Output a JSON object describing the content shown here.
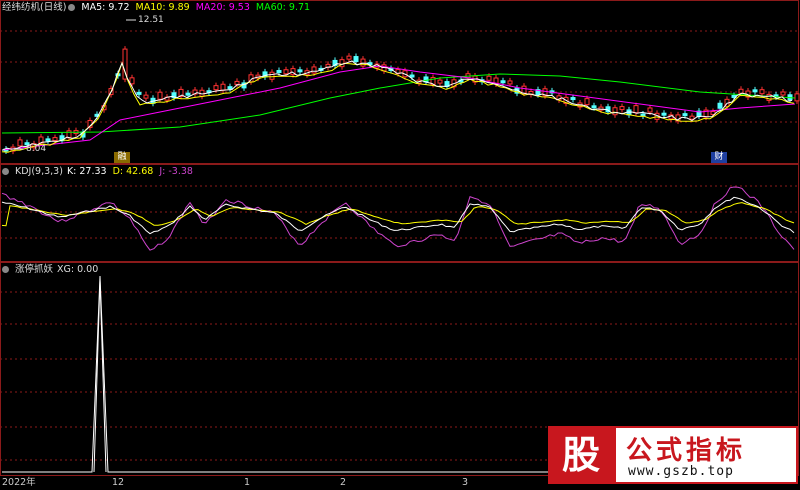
{
  "colors": {
    "ma5": "#ffffff",
    "ma10": "#ffff00",
    "ma20": "#ff00ff",
    "ma60": "#00ff00",
    "up": "#ff3232",
    "down": "#54ffff",
    "frame": "#8b1a1a",
    "kdj_k": "#ffffff",
    "kdj_d": "#ffff00",
    "kdj_j": "#cc44cc"
  },
  "price_panel": {
    "title": "经纬纺机(日线)",
    "ma5": "MA5: 9.72",
    "ma10": "MA10: 9.89",
    "ma20": "MA20: 9.53",
    "ma60": "MA60: 9.71",
    "high_mark": "12.51",
    "low_mark": "8.04",
    "badge_left": "融",
    "badge_right": "财"
  },
  "kdj_panel": {
    "title": "KDJ(9,3,3)",
    "k": "K: 27.33",
    "d": "D: 42.68",
    "j": "J: -3.38"
  },
  "xg_panel": {
    "title": "涨停抓妖",
    "xg": "XG: 0.00"
  },
  "time_axis": {
    "labels": [
      "2022年",
      "12",
      "1",
      "2",
      "3"
    ]
  },
  "watermark": {
    "logo_char": "股",
    "title": "公式指标",
    "url": "www.gszb.top"
  },
  "chart_data": {
    "type": "line",
    "price_panel": {
      "high": 12.51,
      "low": 8.04,
      "ma_last": {
        "MA5": 9.72,
        "MA10": 9.89,
        "MA20": 9.53,
        "MA60": 9.71
      }
    },
    "kdj_last": {
      "K": 27.33,
      "D": 42.68,
      "J": -3.38
    },
    "xg_last": 0.0
  }
}
